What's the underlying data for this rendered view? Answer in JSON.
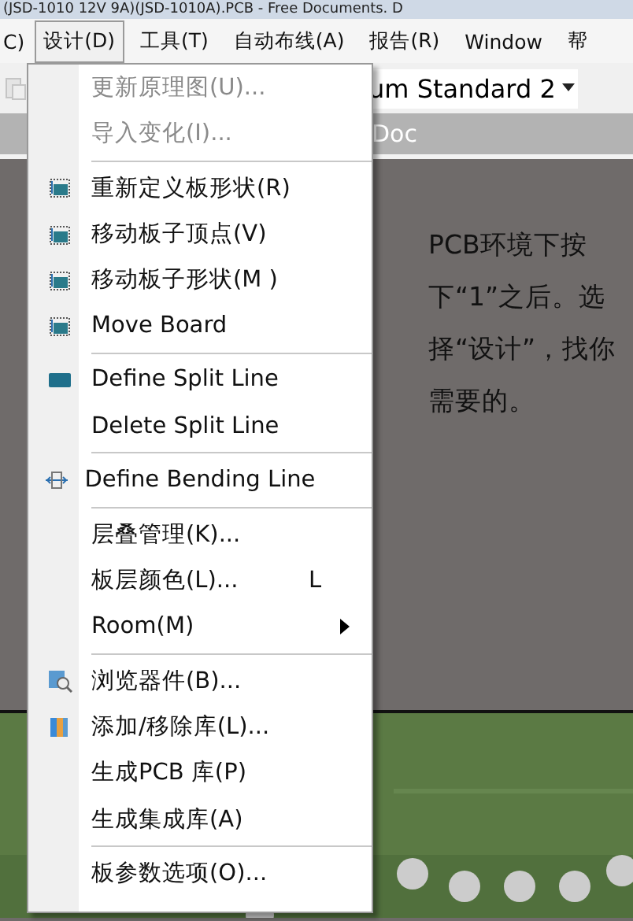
{
  "window": {
    "title": "(JSD-1010 12V 9A)(JSD-1010A).PCB - Free Documents. D"
  },
  "menu_bar": [
    {
      "label": "C)",
      "selected": false
    },
    {
      "label": "设计(D)",
      "selected": true
    },
    {
      "label": "工具(T)",
      "selected": false
    },
    {
      "label": "自动布线(A)",
      "selected": false
    },
    {
      "label": "报告(R)",
      "selected": false
    },
    {
      "label": "Window",
      "selected": false
    },
    {
      "label": "帮",
      "selected": false
    }
  ],
  "toolbar": {
    "dropdown": "um Standard 2"
  },
  "document_tab": {
    "label": "Doc"
  },
  "note": "PCB环境下按下“1”之后。选择“设计”，找你需要的。",
  "menu": [
    {
      "kind": "item",
      "label": "更新原理图(U)...",
      "disabled": true,
      "has_icon": false
    },
    {
      "kind": "item",
      "label": "导入变化(I)...",
      "disabled": true,
      "has_icon": false
    },
    {
      "kind": "separator"
    },
    {
      "kind": "item",
      "label": "重新定义板形状(R)",
      "disabled": false,
      "has_icon": true
    },
    {
      "kind": "item",
      "label": "移动板子顶点(V)",
      "disabled": false,
      "has_icon": true
    },
    {
      "kind": "item",
      "label": "移动板子形状(M )",
      "disabled": false,
      "has_icon": true
    },
    {
      "kind": "item",
      "label": "Move Board",
      "disabled": false,
      "has_icon": true
    },
    {
      "kind": "separator"
    },
    {
      "kind": "item",
      "label": "Define Split Line",
      "disabled": false,
      "has_icon": true
    },
    {
      "kind": "item",
      "label": "Delete Split Line",
      "disabled": false,
      "has_icon": false
    },
    {
      "kind": "separator"
    },
    {
      "kind": "item",
      "label": "Define Bending Line",
      "disabled": false,
      "has_icon": true
    },
    {
      "kind": "separator"
    },
    {
      "kind": "item",
      "label": "层叠管理(K)...",
      "disabled": false,
      "has_icon": false
    },
    {
      "kind": "item",
      "label": "板层颜色(L)...",
      "disabled": false,
      "has_icon": false,
      "shortcut": "L"
    },
    {
      "kind": "item",
      "label": "Room(M)",
      "disabled": false,
      "has_icon": false,
      "submenu": true
    },
    {
      "kind": "separator"
    },
    {
      "kind": "item",
      "label": "浏览器件(B)...",
      "disabled": false,
      "has_icon": true
    },
    {
      "kind": "item",
      "label": "添加/移除库(L)...",
      "disabled": false,
      "has_icon": true
    },
    {
      "kind": "item",
      "label": "生成PCB 库(P)",
      "disabled": false,
      "has_icon": false
    },
    {
      "kind": "item",
      "label": "生成集成库(A)",
      "disabled": false,
      "has_icon": false
    },
    {
      "kind": "separator"
    },
    {
      "kind": "item",
      "label": "板参数选项(O)...",
      "disabled": false,
      "has_icon": false
    }
  ]
}
